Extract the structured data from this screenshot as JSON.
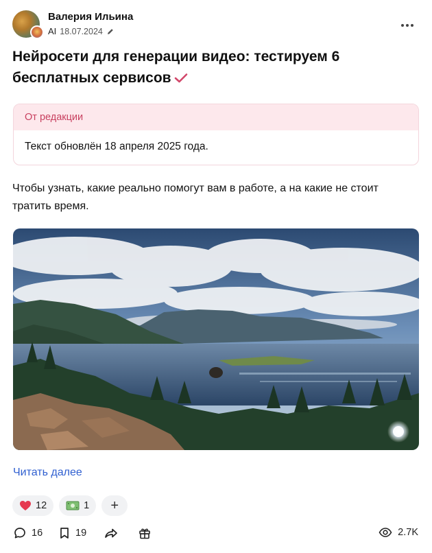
{
  "post": {
    "author": "Валерия Ильина",
    "ai_label": "AI",
    "date": "18.07.2024",
    "title": "Нейросети для генерации видео: тестируем 6 бесплатных сервисов",
    "editor_note": {
      "heading": "От редакции",
      "text": "Текст обновлён 18 апреля 2025 года."
    },
    "intro": "Чтобы узнать, какие реально помогут вам в работе, а на какие не стоит тратить время.",
    "read_more": "Читать далее"
  },
  "reactions": {
    "heart_count": "12",
    "money_count": "1",
    "add_label": "+"
  },
  "footer": {
    "comments": "16",
    "bookmarks": "19",
    "views": "2.7K"
  },
  "colors": {
    "accent": "#d2476a",
    "link": "#2f5fd0",
    "editor_bg": "#fde8ec"
  },
  "icons": [
    "more-icon",
    "pencil-icon",
    "verified-check-icon",
    "heart-icon",
    "money-icon",
    "add-icon",
    "comment-icon",
    "bookmark-icon",
    "share-icon",
    "gift-icon",
    "eye-icon"
  ]
}
